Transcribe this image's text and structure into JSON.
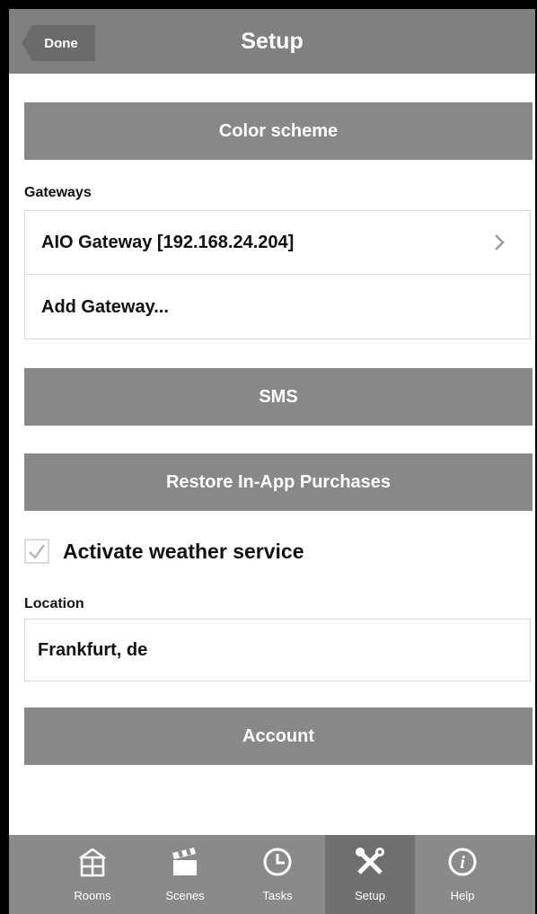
{
  "navbar": {
    "back_label": "Done",
    "title": "Setup"
  },
  "buttons": {
    "color_scheme": "Color scheme",
    "sms": "SMS",
    "restore": "Restore In-App Purchases",
    "account": "Account"
  },
  "gateways": {
    "label": "Gateways",
    "items": [
      {
        "label": "AIO Gateway [192.168.24.204]"
      },
      {
        "label": "Add Gateway..."
      }
    ]
  },
  "weather": {
    "label": "Activate weather service",
    "checked": true
  },
  "location": {
    "label": "Location",
    "value": "Frankfurt, de"
  },
  "tabs": [
    {
      "label": "Rooms",
      "icon": "house-icon",
      "active": false
    },
    {
      "label": "Scenes",
      "icon": "clapperboard-icon",
      "active": false
    },
    {
      "label": "Tasks",
      "icon": "clock-icon",
      "active": false
    },
    {
      "label": "Setup",
      "icon": "tools-icon",
      "active": true
    },
    {
      "label": "Help",
      "icon": "info-icon",
      "active": false
    }
  ],
  "colors": {
    "navbar": "#808080",
    "button": "#888888",
    "tabbar": "#8a8a8a",
    "tab_active": "#707070"
  }
}
